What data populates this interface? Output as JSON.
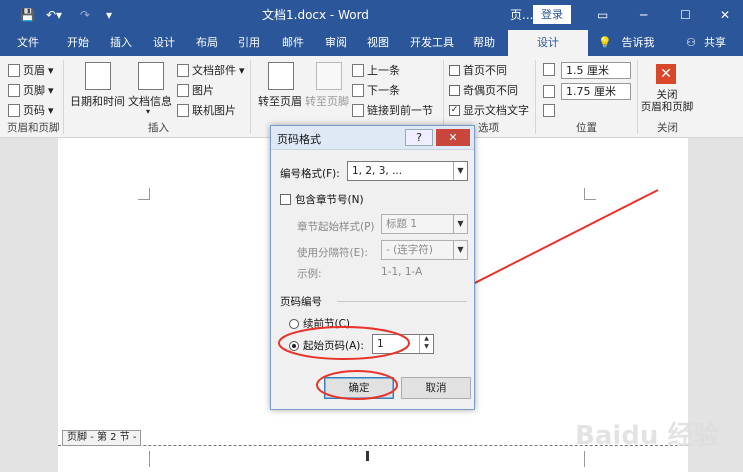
{
  "title_bar": {
    "icons": [
      "save-icon",
      "undo-icon",
      "redo-icon",
      "customize-qat-icon"
    ],
    "document_title": "文档1.docx - Word",
    "context_label": "页...",
    "login_label": "登录"
  },
  "tabs": [
    "文件",
    "开始",
    "插入",
    "设计",
    "布局",
    "引用",
    "邮件",
    "审阅",
    "视图",
    "开发工具",
    "帮助",
    "设计"
  ],
  "tell_me": "告诉我",
  "share": "共享",
  "ribbon": {
    "header_footer": {
      "header": "页眉",
      "footer": "页脚",
      "page_number": "页码",
      "group": "页眉和页脚"
    },
    "insert": {
      "date_time": "日期和时间",
      "doc_info": "文档信息",
      "doc_parts": "文档部件",
      "picture": "图片",
      "online_picture": "联机图片",
      "group": "插入"
    },
    "navigation": {
      "goto_header": "转至页眉",
      "goto_footer": "转至页脚",
      "previous": "上一条",
      "next": "下一条",
      "link_previous": "链接到前一节"
    },
    "options": {
      "first_page_diff": "首页不同",
      "odd_even_diff": "奇偶页不同",
      "show_doc_text": "显示文档文字",
      "group": "选项"
    },
    "position": {
      "header_top": "1.5 厘米",
      "footer_bottom": "1.75 厘米",
      "group": "位置"
    },
    "close": {
      "label": "关闭\n页眉和页脚",
      "group": "关闭"
    }
  },
  "dialog": {
    "title": "页码格式",
    "number_format_label": "编号格式(F):",
    "number_format_value": "1, 2, 3, ...",
    "include_chapter": "包含章节号(N)",
    "chapter_style_label": "章节起始样式(P)",
    "chapter_style_value": "标题 1",
    "separator_label": "使用分隔符(E):",
    "separator_value": "-  (连字符)",
    "example_label": "示例:",
    "example_value": "1-1, 1-A",
    "page_numbering_section": "页码编号",
    "continue_prev": "续前节(C)",
    "start_at_label": "起始页码(A):",
    "start_at_value": "1",
    "ok": "确定",
    "cancel": "取消"
  },
  "document": {
    "footer_tag": "页脚 - 第 2 节 -"
  },
  "watermark": "Baidu 经验"
}
